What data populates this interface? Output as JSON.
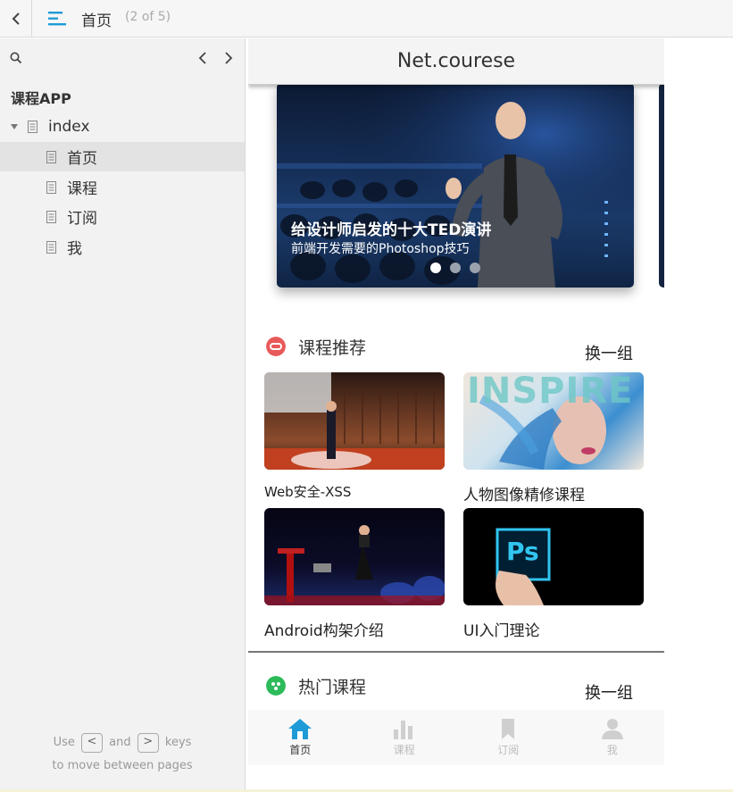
{
  "toolbar": {
    "title": "首页",
    "page_count": "(2 of 5)"
  },
  "sidebar": {
    "project": "课程APP",
    "tree": [
      {
        "label": "index",
        "type": "folder"
      },
      {
        "label": "首页",
        "type": "page",
        "selected": true
      },
      {
        "label": "课程",
        "type": "page"
      },
      {
        "label": "订阅",
        "type": "page"
      },
      {
        "label": "我",
        "type": "page"
      }
    ],
    "help": {
      "use": "Use",
      "key_prev": "<",
      "and": "and",
      "key_next": ">",
      "keys": "keys",
      "line2": "to move between pages"
    }
  },
  "app": {
    "header_title": "Net.courese",
    "banner": {
      "title": "给设计师启发的十大TED演讲",
      "subtitle": "前端开发需要的Photoshop技巧",
      "dots": 3,
      "active_dot": 0
    },
    "recommend": {
      "title": "课程推荐",
      "refresh": "换一组",
      "icon_color": "#e85a5a",
      "cards": [
        {
          "caption": "Web安全-XSS"
        },
        {
          "caption": "人物图像精修课程",
          "art_text": "INSPIRE"
        },
        {
          "caption": "Android构架介绍"
        },
        {
          "caption": "UI入门理论",
          "art_text": "Ps"
        }
      ]
    },
    "popular": {
      "title": "热门课程",
      "refresh": "换一组",
      "icon_color": "#2dbb5a"
    },
    "tabs": [
      {
        "label": "首页",
        "icon": "home-icon",
        "active": true
      },
      {
        "label": "课程",
        "icon": "bar-chart-icon"
      },
      {
        "label": "订阅",
        "icon": "bookmark-icon"
      },
      {
        "label": "我",
        "icon": "user-icon"
      }
    ],
    "accent": "#1e9bd7"
  }
}
